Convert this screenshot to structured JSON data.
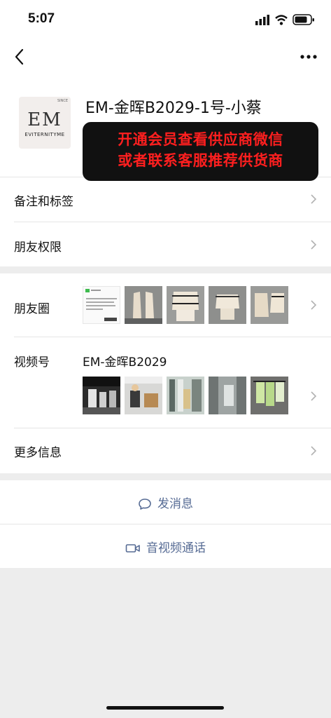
{
  "status": {
    "time": "5:07"
  },
  "profile": {
    "name": "EM-金晖B2029-1号-小蔡",
    "avatar_initials": "EM",
    "avatar_brand": "EVITERNITYME",
    "avatar_small": "SINCE"
  },
  "promo": {
    "line1": "开通会员查看供应商微信",
    "line2": "或者联系客服推荐供货商",
    "color": "#ff1f1f"
  },
  "menu": {
    "remarks_tags": "备注和标签",
    "friend_permissions": "朋友权限",
    "moments": "朋友圈",
    "channels": "视频号",
    "channels_name": "EM-金晖B2029",
    "more_info": "更多信息"
  },
  "actions": {
    "send_message": "发消息",
    "video_call": "音视频通话"
  },
  "colors": {
    "link": "#566b94",
    "background": "#ededed"
  }
}
